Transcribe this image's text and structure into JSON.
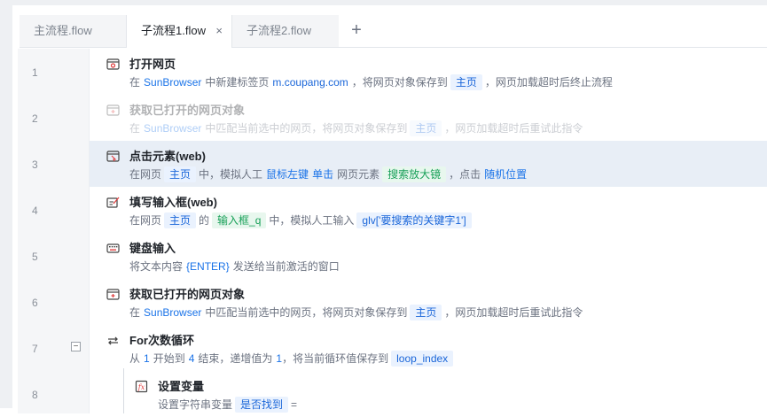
{
  "tabs": [
    {
      "label": "主流程.flow"
    },
    {
      "label": "子流程1.flow",
      "close": "×"
    },
    {
      "label": "子流程2.flow"
    }
  ],
  "tab_add": "+",
  "collapse_toggle": "−",
  "line_numbers": [
    "1",
    "2",
    "3",
    "4",
    "5",
    "6",
    "7",
    "8"
  ],
  "steps": [
    {
      "title": "打开网页",
      "desc": {
        "p1": "在",
        "browser": "SunBrowser",
        "p2": "中新建标签页",
        "url": "m.coupang.com",
        "p3": "，将网页对象保存到",
        "var": "主页",
        "p4": "，网页加载超时后终止流程"
      }
    },
    {
      "title": "获取已打开的网页对象",
      "desc": {
        "p1": "在",
        "browser": "SunBrowser",
        "p2": "中匹配当前选中的网页，将网页对象保存到",
        "var": "主页",
        "p3": "，网页加载超时后重试此指令"
      }
    },
    {
      "title": "点击元素(web)",
      "desc": {
        "p1": "在网页",
        "page": "主页",
        "p2": "中，模拟人工",
        "button": "鼠标左键",
        "click": "单击",
        "p3": "网页元素",
        "element": "搜索放大镜",
        "p4": "，点击",
        "pos": "随机位置"
      }
    },
    {
      "title": "填写输入框(web)",
      "desc": {
        "p1": "在网页",
        "page": "主页",
        "p2": "的",
        "element": "输入框_q",
        "p3": "中，模拟人工输入",
        "value": "glv['要搜索的关键字1']"
      }
    },
    {
      "title": "键盘输入",
      "desc": {
        "p1": "将文本内容",
        "key": "{ENTER}",
        "p2": "发送给当前激活的窗口"
      }
    },
    {
      "title": "获取已打开的网页对象",
      "desc": {
        "p1": "在",
        "browser": "SunBrowser",
        "p2": "中匹配当前选中的网页，将网页对象保存到",
        "var": "主页",
        "p3": "，网页加载超时后重试此指令"
      }
    },
    {
      "title": "For次数循环",
      "desc": {
        "p1": "从",
        "start": "1",
        "p2": "开始到",
        "end": "4",
        "p3": "结束，递增值为",
        "step": "1",
        "p4": "，将当前循环值保存到",
        "var": "loop_index"
      }
    },
    {
      "title": "设置变量",
      "desc": {
        "p1": "设置字符串变量",
        "var": "是否找到",
        "p2": "="
      }
    }
  ],
  "colors": {
    "accent": "#1a73e8",
    "selected_row": "#e8eef6",
    "chip_blue": "#eaf2fe",
    "chip_green": "#e8f7ee"
  }
}
